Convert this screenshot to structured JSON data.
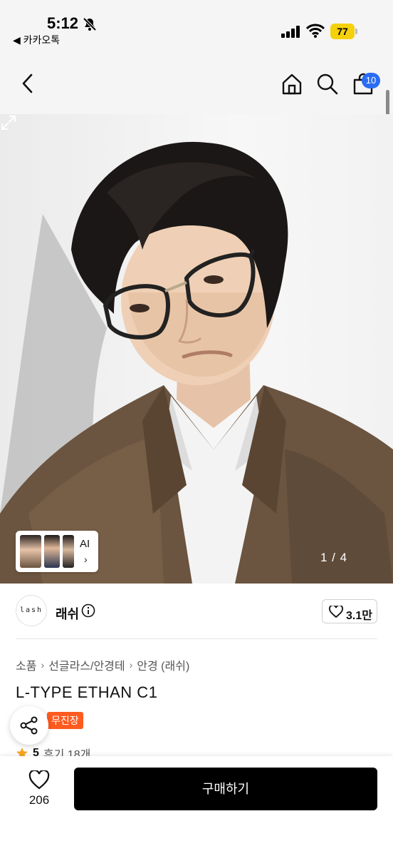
{
  "status_bar": {
    "time": "5:12",
    "back_app": "◀ 카카오톡",
    "battery": "77",
    "bell_icon": "bell-slash-icon",
    "signal_icon": "signal-icon",
    "wifi_icon": "wifi-icon"
  },
  "nav": {
    "back_icon": "chevron-left-icon",
    "home_icon": "home-icon",
    "search_icon": "search-icon",
    "cart_icon": "cart-icon",
    "cart_badge": "10",
    "badge_color": "#2a6df4"
  },
  "gallery": {
    "thumbs_label": "AI",
    "page_indicator": "1 / 4",
    "expand_icon": "expand-icon"
  },
  "seller": {
    "logo_text": "lash",
    "name": "래쉬",
    "likes": "3.1만"
  },
  "breadcrumb": [
    "소품",
    "선글라스/안경테",
    "안경 (래쉬)"
  ],
  "product": {
    "title": "L-TYPE ETHAN C1",
    "tag": "무진장",
    "tag_color": "#ff5a1f",
    "rating": "5",
    "reviews": "후기 18개"
  },
  "bottom_bar": {
    "favorite_count": "206",
    "buy_label": "구매하기"
  }
}
